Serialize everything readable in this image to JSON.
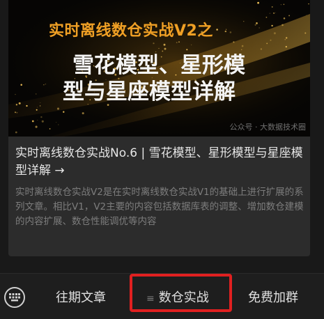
{
  "article": {
    "cover": {
      "subtitle": "实时离线数仓实战V2之",
      "title_line1": "雪花模型、星形模",
      "title_line2": "型与星座模型详解",
      "watermark": "公众号 · 大数据技术圈"
    },
    "title": "实时离线数仓实战No.6 | 雪花模型、星形模型与星座模型详解 →",
    "description": "实时离线数仓实战V2是在实时离线数仓实战V1的基础上进行扩展的系列文章。相比V1，V2主要的内容包括数据库表的调整、增加数仓建模的内容扩展、数仓性能调优等内容"
  },
  "bottom_menu": {
    "keyboard_icon": "keyboard-icon",
    "items": [
      {
        "label": "往期文章"
      },
      {
        "label": "数仓实战",
        "icon": "≡"
      },
      {
        "label": "免费加群"
      }
    ],
    "highlight_color": "#e02020"
  }
}
